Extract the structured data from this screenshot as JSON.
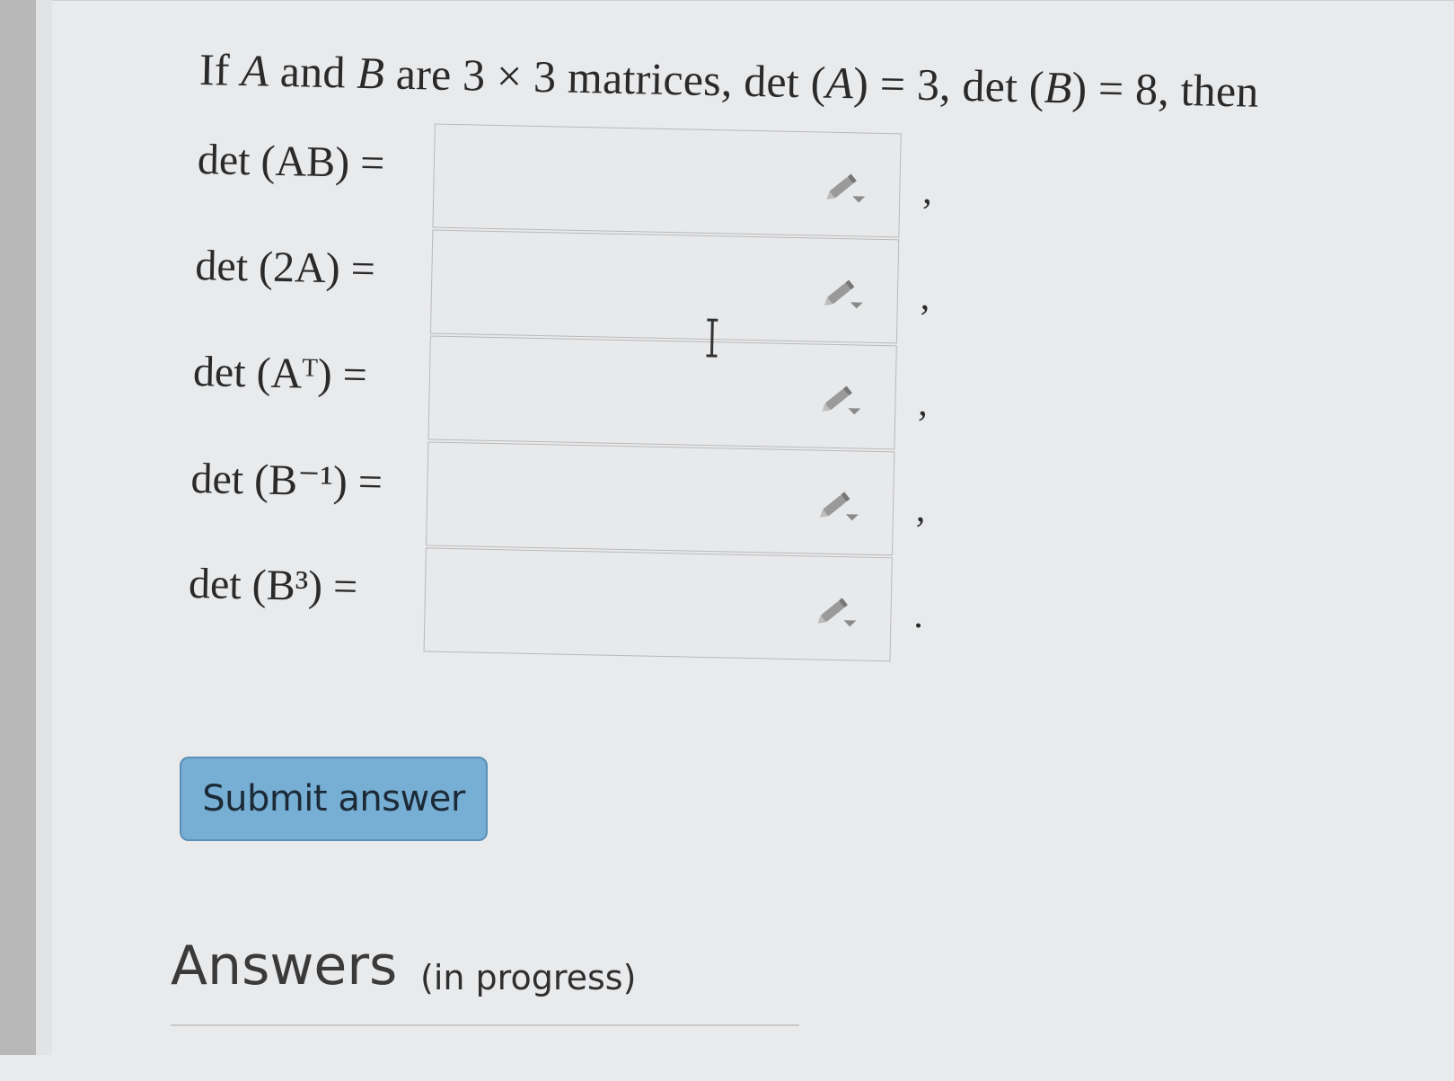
{
  "question": {
    "prefix": "If ",
    "var_a": "A",
    "and": " and ",
    "var_b": "B",
    "mid": " are 3 × 3 matrices, det (",
    "var_a2": "A",
    "eq1": ") = 3, det (",
    "var_b2": "B",
    "eq2": ") = 8, then"
  },
  "rows": [
    {
      "label": "det (AB) =",
      "value": "",
      "punct": ","
    },
    {
      "label": "det (2A) =",
      "value": "",
      "punct": ","
    },
    {
      "label": "det (Aᵀ) =",
      "value": "",
      "punct": ","
    },
    {
      "label": "det (B⁻¹) =",
      "value": "",
      "punct": ","
    },
    {
      "label": "det (B³) =",
      "value": "",
      "punct": "."
    }
  ],
  "submit_label": "Submit answer",
  "answers": {
    "title": "Answers",
    "status": "(in progress)"
  },
  "colors": {
    "submit_bg": "#77aed4",
    "submit_border": "#5b8fb6",
    "page_bg": "#e9eaec"
  }
}
